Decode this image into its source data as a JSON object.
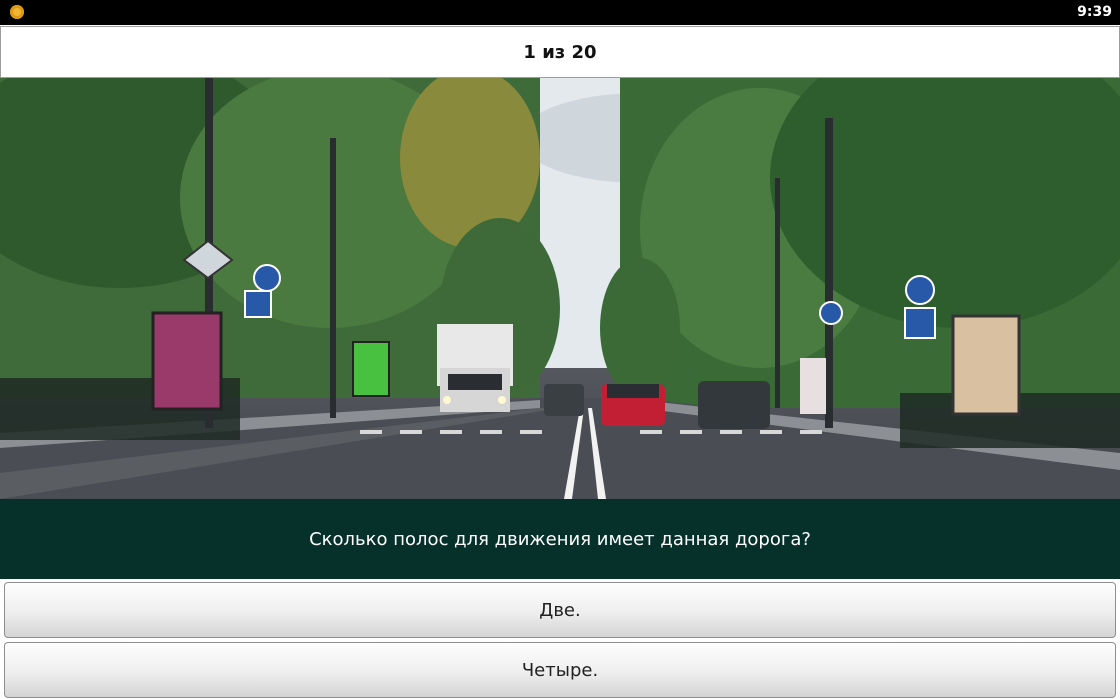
{
  "status_bar": {
    "time": "9:39",
    "app_icon": "coin-icon"
  },
  "header": {
    "progress": "1 из 20"
  },
  "image": {
    "description_icon": "road-photo"
  },
  "question": {
    "text": "Сколько полос для движения имеет данная дорога?"
  },
  "answers": [
    {
      "label": "Две."
    },
    {
      "label": "Четыре."
    }
  ],
  "colors": {
    "status_bar_bg": "#000000",
    "question_bg": "#06302a",
    "answer_bg": "#e6e6e6"
  }
}
